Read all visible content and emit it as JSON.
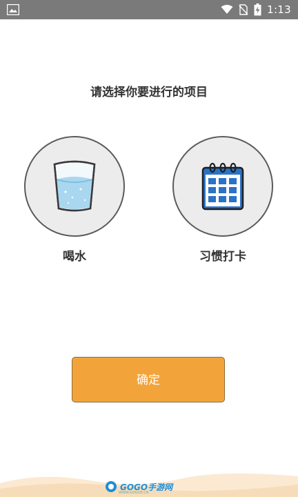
{
  "status_bar": {
    "time": "1:13",
    "icons": [
      "gallery-icon",
      "wifi-icon",
      "no-sim-icon",
      "battery-charging-icon"
    ],
    "background": "#7a7a7a"
  },
  "prompt": "请选择你要进行的项目",
  "options": [
    {
      "label": "喝水",
      "icon": "water-glass-icon"
    },
    {
      "label": "习惯打卡",
      "icon": "calendar-icon"
    }
  ],
  "confirm_label": "确定",
  "watermark": {
    "text": "GOGO手游网",
    "sub": "WWW.GOGOE.CN"
  },
  "colors": {
    "accent": "#f2a43b",
    "circle_bg": "#ececec",
    "calendar_blue": "#2a73c6"
  }
}
